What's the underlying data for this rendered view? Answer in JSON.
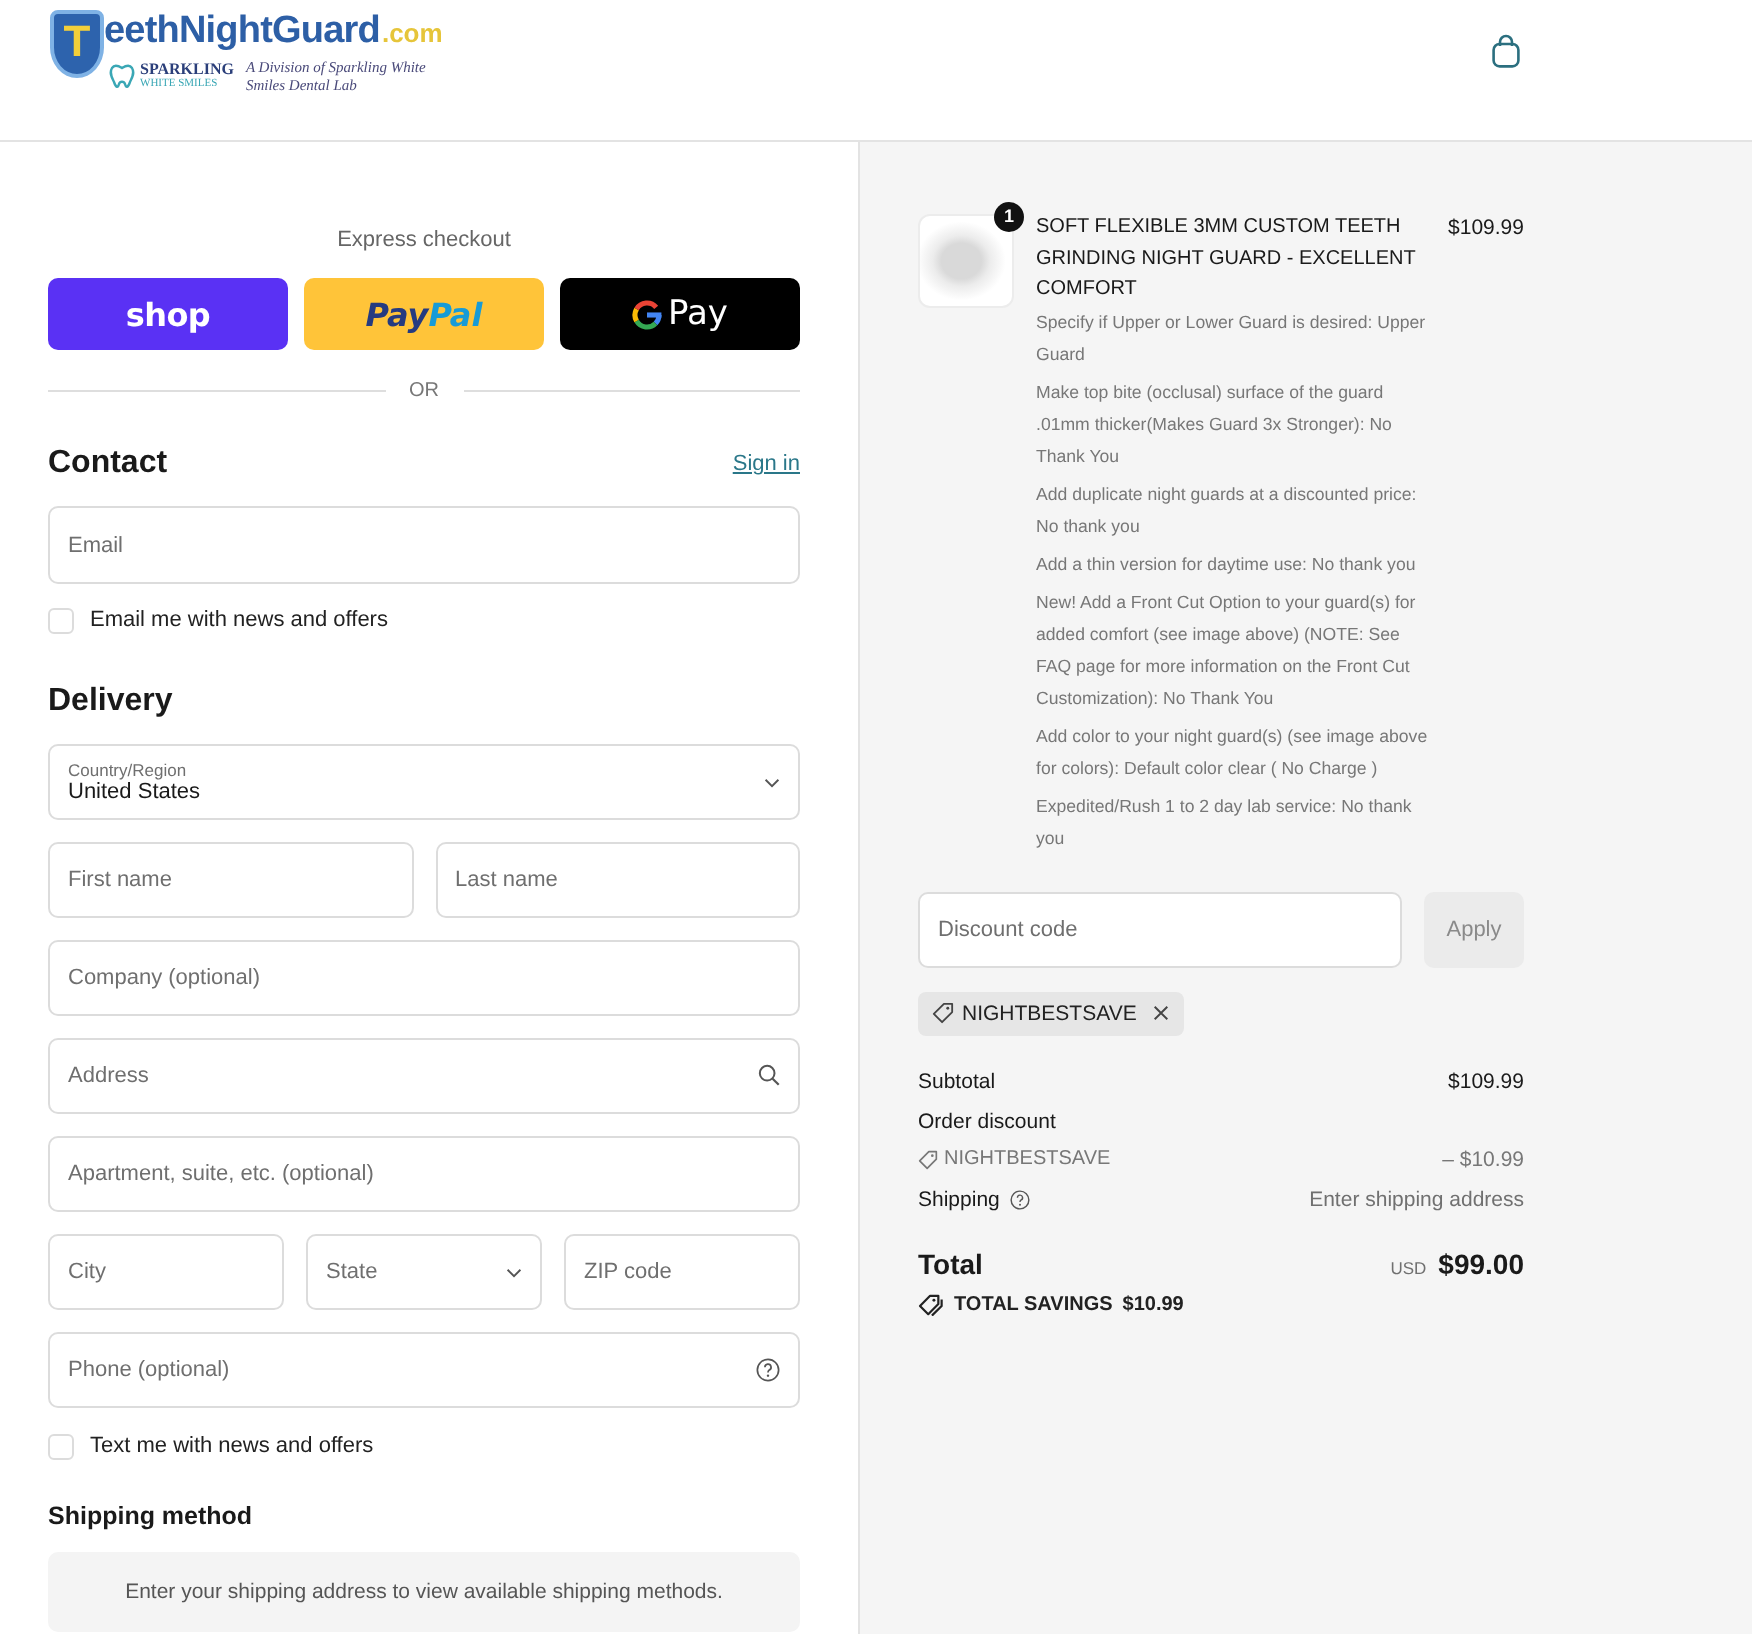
{
  "header": {
    "logo": {
      "initial": "T",
      "name": "eethNightGuard",
      "tld": ".com",
      "sub_brand_top": "SPARKLING",
      "sub_brand_bottom": "WHITE SMILES",
      "tagline": "A Division of Sparkling White Smiles Dental Lab"
    }
  },
  "express_checkout": {
    "title": "Express checkout",
    "buttons": [
      {
        "kind": "shop",
        "label_parts": [
          "shop"
        ]
      },
      {
        "kind": "paypal",
        "label_parts": [
          "Pay",
          "Pal"
        ]
      },
      {
        "kind": "gpay",
        "label_parts": [
          "Pay"
        ]
      }
    ],
    "divider": "OR"
  },
  "contact": {
    "title": "Contact",
    "sign_in": "Sign in",
    "email": {
      "placeholder": "Email"
    },
    "news_opt_in": {
      "label": "Email me with news and offers",
      "checked": false
    }
  },
  "delivery": {
    "title": "Delivery",
    "rows": [
      [
        {
          "kind": "select",
          "label": "Country/Region",
          "value": "United States"
        }
      ],
      [
        {
          "kind": "text",
          "placeholder": "First name"
        },
        {
          "kind": "text",
          "placeholder": "Last name"
        }
      ],
      [
        {
          "kind": "text",
          "placeholder": "Company (optional)"
        }
      ],
      [
        {
          "kind": "search",
          "placeholder": "Address"
        }
      ],
      [
        {
          "kind": "text",
          "placeholder": "Apartment, suite, etc. (optional)"
        }
      ],
      [
        {
          "kind": "text",
          "placeholder": "City"
        },
        {
          "kind": "select",
          "placeholder": "State"
        },
        {
          "kind": "text",
          "placeholder": "ZIP code"
        }
      ],
      [
        {
          "kind": "help",
          "placeholder": "Phone (optional)"
        }
      ]
    ],
    "sms_opt_in": {
      "label": "Text me with news and offers",
      "checked": false
    }
  },
  "shipping_method": {
    "title": "Shipping method",
    "notice": "Enter your shipping address to view available shipping methods."
  },
  "order_summary": {
    "items": [
      {
        "quantity": "1",
        "title": "SOFT FLEXIBLE 3MM CUSTOM TEETH GRINDING NIGHT GUARD - EXCELLENT COMFORT",
        "price": "$109.99",
        "properties": [
          "Specify if Upper or Lower Guard is desired: Upper Guard",
          "Make top bite (occlusal) surface of the guard .01mm thicker(Makes Guard 3x Stronger): No Thank You",
          "Add duplicate night guards at a discounted price: No thank you",
          "Add a thin version for daytime use: No thank you",
          "New! Add a Front Cut Option to your guard(s) for added comfort (see image above) (NOTE: See FAQ page for more information on the Front Cut Customization): No Thank You",
          "Add color to your night guard(s) (see image above for colors): Default color clear ( No Charge )",
          "Expedited/Rush 1 to 2 day lab service: No thank you"
        ]
      }
    ],
    "discount": {
      "placeholder": "Discount code",
      "apply": {
        "label": "Apply",
        "disabled": true
      }
    },
    "applied_codes": [
      {
        "code": "NIGHTBESTSAVE"
      }
    ],
    "lines": [
      {
        "kind": "subtotal",
        "label": "Subtotal",
        "value": "$109.99"
      },
      {
        "kind": "discount",
        "label": "Order discount",
        "code": "NIGHTBESTSAVE",
        "value": "– $10.99"
      },
      {
        "kind": "shipping",
        "label": "Shipping",
        "value": "Enter shipping address"
      }
    ],
    "total": {
      "label": "Total",
      "currency": "USD",
      "value": "$99.00"
    },
    "savings": {
      "label": "TOTAL SAVINGS",
      "value": "$10.99"
    }
  }
}
